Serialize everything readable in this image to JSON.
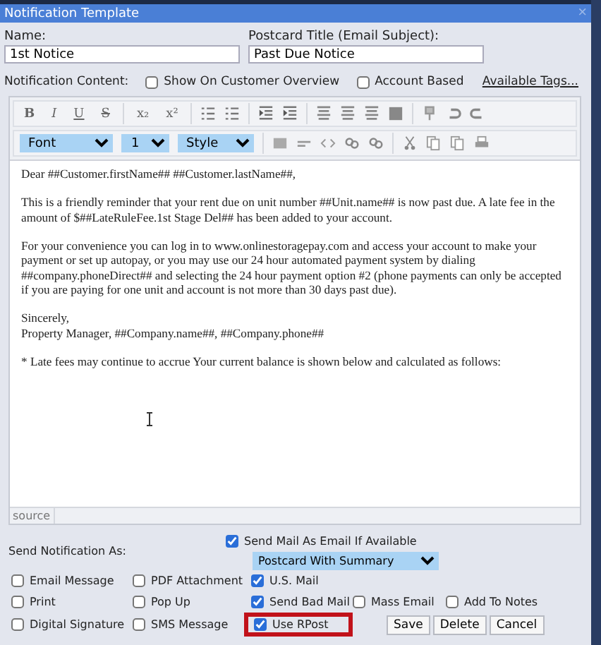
{
  "window": {
    "title": "Notification Template",
    "close": "×"
  },
  "name": {
    "label": "Name:",
    "value": "1st Notice"
  },
  "postcard_title": {
    "label": "Postcard Title (Email Subject):",
    "value": "Past Due Notice"
  },
  "content_row": {
    "label": "Notification Content:",
    "options": [
      {
        "label": "Show On Customer Overview",
        "checked": false
      },
      {
        "label": "Account Based",
        "checked": false
      }
    ],
    "link": "Available Tags..."
  },
  "toolbar": {
    "format_buttons": [
      "B",
      "I",
      "U",
      "S",
      "x₂",
      "x²"
    ],
    "selects": [
      {
        "value": "Font"
      },
      {
        "value": "1"
      },
      {
        "value": "Style"
      }
    ]
  },
  "editor": {
    "paragraphs": [
      [
        "Dear ##Customer.firstName## ##Customer.lastName##,"
      ],
      [
        "This is a friendly reminder that your rent due on unit number ##Unit.name## is now past due. A late fee in the amount of $##LateRuleFee.1st Stage Del## has been added to your account."
      ],
      [
        "For your convenience you can log in to www.onlinestoragepay.com and access your account to make your payment or set up autopay, or you may use our 24 hour automated payment system by dialing ##company.phoneDirect## and selecting the 24 hour payment option #2 (phone payments can only be accepted if you are paying for one unit and account is not more than 30 days past due)."
      ],
      [
        "Sincerely,",
        "Property Manager, ##Company.name##, ##Company.phone##"
      ],
      [
        "* Late fees may continue to accrue Your current balance is shown below and calculated as follows:"
      ]
    ],
    "source_tab": "source"
  },
  "send_as": {
    "label": "Send Notification As:",
    "send_mail_as_email": {
      "label": "Send Mail As Email If Available",
      "checked": true
    },
    "mail_type": {
      "value": "Postcard With Summary"
    },
    "options": [
      {
        "label": "Email Message",
        "checked": false,
        "highlighted": false
      },
      {
        "label": "PDF Attachment",
        "checked": false,
        "highlighted": false
      },
      {
        "label": "U.S. Mail",
        "checked": true,
        "highlighted": false
      },
      {
        "label": "Print",
        "checked": false,
        "highlighted": false
      },
      {
        "label": "Pop Up",
        "checked": false,
        "highlighted": false
      },
      {
        "label": "Send Bad Mail",
        "checked": true,
        "highlighted": false
      },
      {
        "label": "Mass Email",
        "checked": false,
        "highlighted": false
      },
      {
        "label": "Add To Notes",
        "checked": false,
        "highlighted": false
      },
      {
        "label": "Digital Signature",
        "checked": false,
        "highlighted": false
      },
      {
        "label": "SMS Message",
        "checked": false,
        "highlighted": false
      },
      {
        "label": "Use RPost",
        "checked": true,
        "highlighted": true
      }
    ]
  },
  "buttons": [
    "Save",
    "Delete",
    "Cancel"
  ]
}
